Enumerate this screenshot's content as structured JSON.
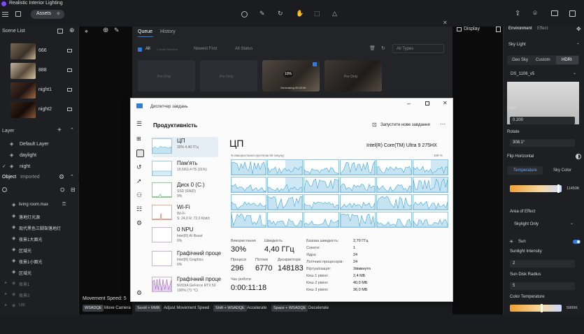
{
  "app": {
    "title": "Realistic Interior Lighting",
    "assets_label": "Assets"
  },
  "scene": {
    "title": "Scene List",
    "items": [
      {
        "name": "666"
      },
      {
        "name": "888"
      },
      {
        "name": "night1"
      },
      {
        "name": "night2"
      }
    ]
  },
  "layer": {
    "title": "Layer",
    "items": [
      "Default Layer",
      "daylight",
      "night"
    ]
  },
  "object": {
    "tabs": [
      "Object",
      "Imported"
    ],
    "items": [
      "living room.max",
      "落地灯光源",
      "现代黑色三脚架落地灯",
      "夜景1大面光",
      "区域光",
      "夜景1小面光",
      "区域光",
      "夜景1",
      "夜景2",
      "Util"
    ]
  },
  "queue": {
    "tabs": [
      "Queue",
      "History"
    ],
    "all": "All",
    "selected": "1 Items Selected",
    "sort": "Newest First",
    "status": "All Status",
    "type": "All Types",
    "card_labels": [
      "Pre Only",
      "Pre Only",
      "10%",
      "Pre Only"
    ],
    "card_status": "Generating 00:02:30"
  },
  "viewport": {
    "display": "Display",
    "movement": "Movement Speed: 5"
  },
  "shortcuts": [
    {
      "key": "WSADQE",
      "label": "Move Camera"
    },
    {
      "key": "Scroll + RMB",
      "label": "Adjust Movement Speed"
    },
    {
      "key": "Shift + WSADQE",
      "label": "Accelerate"
    },
    {
      "key": "Space + WSADQE",
      "label": "Decelerate"
    }
  ],
  "env": {
    "tabs": [
      "Environment",
      "Effect"
    ],
    "sky_light": "Sky Light",
    "sky_tabs": [
      "Geo Sky",
      "Custom",
      "HDRI"
    ],
    "hdri": "DS_1106_v5",
    "light_label": "Light",
    "light_value": "0.200",
    "rotate_label": "Rotate",
    "rotate_value": "308.1°",
    "flip_label": "Flip Horizontal",
    "temp_tabs": [
      "Temperature",
      "Sky Color"
    ],
    "temp_value": "11450K",
    "area_label": "Area of Effect",
    "area_value": "Skylight Only",
    "sun_label": "Sun",
    "sun_intensity_label": "Sunlight Intensity",
    "sun_intensity": "2",
    "sun_disk_label": "Sun Disk Radius",
    "sun_disk": "5",
    "color_temp_label": "Color Temperature",
    "color_temp_value": "5900K"
  },
  "tm": {
    "title": "Диспетчер завдань",
    "section": "Продуктивність",
    "run_task": "Запустити нове завдання",
    "side": [
      {
        "title": "ЦП",
        "sub": "30%  4,40 ГГц"
      },
      {
        "title": "Пам'ять",
        "sub": "19,5/63,4 ГБ (31%)"
      },
      {
        "title": "Диск 0 (C:)",
        "sub": "SSD (RAID)",
        "sub2": "9%"
      },
      {
        "title": "Wi-Fi",
        "sub": "Wi-Fi",
        "sub2": "S: 24,0  R: 72,0 Kbit/с"
      },
      {
        "title": "0 NPU",
        "sub": "Intel(R) AI Boost",
        "sub2": "0%"
      },
      {
        "title": "Графічний проце",
        "sub": "Intel(R) Graphics",
        "sub2": "0%"
      },
      {
        "title": "Графічний проце",
        "sub": "NVIDIA GeForce RTX 50",
        "sub2": "100% (71 °C)"
      }
    ],
    "cpu_title": "ЦП",
    "cpu_name": "Intel(R) Core(TM) Ultra 9 275HX",
    "graph_caption": "% використання протягом 60 секунд",
    "graph_max": "100 %",
    "stats": {
      "usage_l": "Використання",
      "usage": "30%",
      "speed_l": "Швидкість",
      "speed": "4,40 ГГц",
      "proc_l": "Процеси",
      "proc": "296",
      "threads_l": "Потоки",
      "threads": "6770",
      "handles_l": "Дескриптори",
      "handles": "148183",
      "uptime_l": "Час роботи",
      "uptime": "0:00:11:18"
    },
    "info": [
      {
        "k": "Базова швидкість:",
        "v": "2,70 ГГц"
      },
      {
        "k": "Сокети:",
        "v": "1"
      },
      {
        "k": "Ядра:",
        "v": "24"
      },
      {
        "k": "Логічних процесорів:",
        "v": "24"
      },
      {
        "k": "Віртуалізація:",
        "v": "Увімкнуто"
      },
      {
        "k": "Кеш 1 рівня:",
        "v": "2,4 МБ"
      },
      {
        "k": "Кеш 2 рівня:",
        "v": "40,0 МБ"
      },
      {
        "k": "Кеш 3 рівня:",
        "v": "36,0 МБ"
      }
    ]
  },
  "colors": {
    "accent": "#2f7de1",
    "tm_graph": "#9fd4ec",
    "panel": "#1e1f22"
  }
}
